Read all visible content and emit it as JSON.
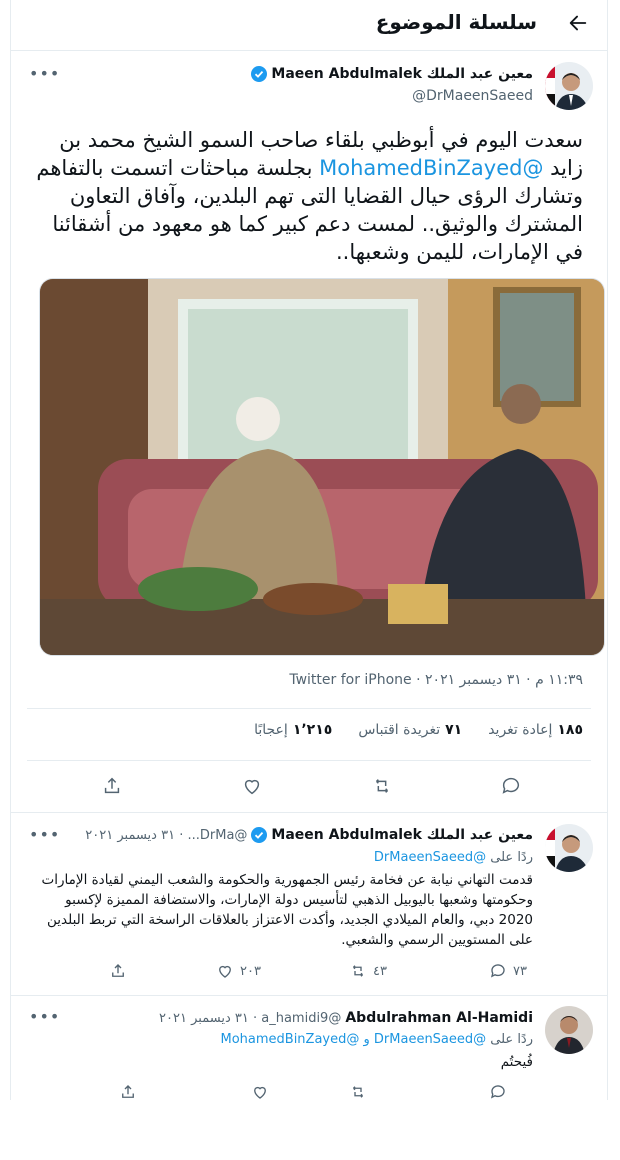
{
  "header": {
    "title": "سلسلة الموضوع"
  },
  "main_tweet": {
    "display_name": "معين عبد الملك Maeen Abdulmalek",
    "handle": "@DrMaeenSaeed",
    "text_part1": "سعدت اليوم في أبوظبي بلقاء صاحب السمو الشيخ محمد بن زايد ",
    "mention": "@MohamedBinZayed",
    "text_part2": " بجلسة مباحثات اتسمت بالتفاهم وتشارك الرؤى حيال القضايا التى تهم البلدين، وآفاق التعاون المشترك والوثيق.. لمست دعم كبير  كما هو معهود من أشقائنا في الإمارات، لليمن وشعبها..",
    "timestamp": "١١:٣٩ م · ٣١ ديسمبر ٢٠٢١ · Twitter for iPhone",
    "stats": {
      "retweets_count": "١٨٥",
      "retweets_label": "إعادة تغريد",
      "quotes_count": "٧١",
      "quotes_label": "تغريدة اقتباس",
      "likes_count": "١٬٢١٥",
      "likes_label": "إعجابًا"
    }
  },
  "replies": [
    {
      "display_name": "معين عبد الملك Maeen Abdulmalek",
      "handle_date": "@DrMa... · ٣١ ديسمبر ٢٠٢١",
      "reply_to_prefix": "ردًا على ",
      "reply_to_handles": "@DrMaeenSaeed",
      "text": "قدمت التهاني نيابة عن فخامة رئيس الجمهورية والحكومة والشعب اليمني لقيادة الإمارات وحكومتها وشعبها باليوبيل الذهبي لتأسيس دولة الإمارات، والاستضافة المميزة لإكسبو 2020 دبي، والعام الميلادي الجديد، وأكدت الاعتزاز بالعلاقات الراسخة التي تربط البلدين على المستويين الرسمي والشعبي.",
      "reply_count": "٧٣",
      "retweet_count": "٤٣",
      "like_count": "٢٠٣"
    },
    {
      "display_name": "Abdulrahman Al-Hamidi",
      "handle_date": "@a_hamidi9 · ٣١ ديسمبر ٢٠٢١",
      "reply_to_prefix": "ردًا على ",
      "reply_to_handles": "@DrMaeenSaeed و @MohamedBinZayed",
      "text": "فُيحتُم",
      "reply_count": "",
      "retweet_count": "",
      "like_count": ""
    }
  ],
  "colors": {
    "accent": "#1d9bf0",
    "mention": "#1b95e0",
    "secondary": "#536471",
    "border": "#e6ecf0"
  },
  "icons": [
    "back-arrow-icon",
    "verified-icon",
    "more-icon",
    "reply-icon",
    "retweet-icon",
    "like-icon",
    "share-icon"
  ]
}
